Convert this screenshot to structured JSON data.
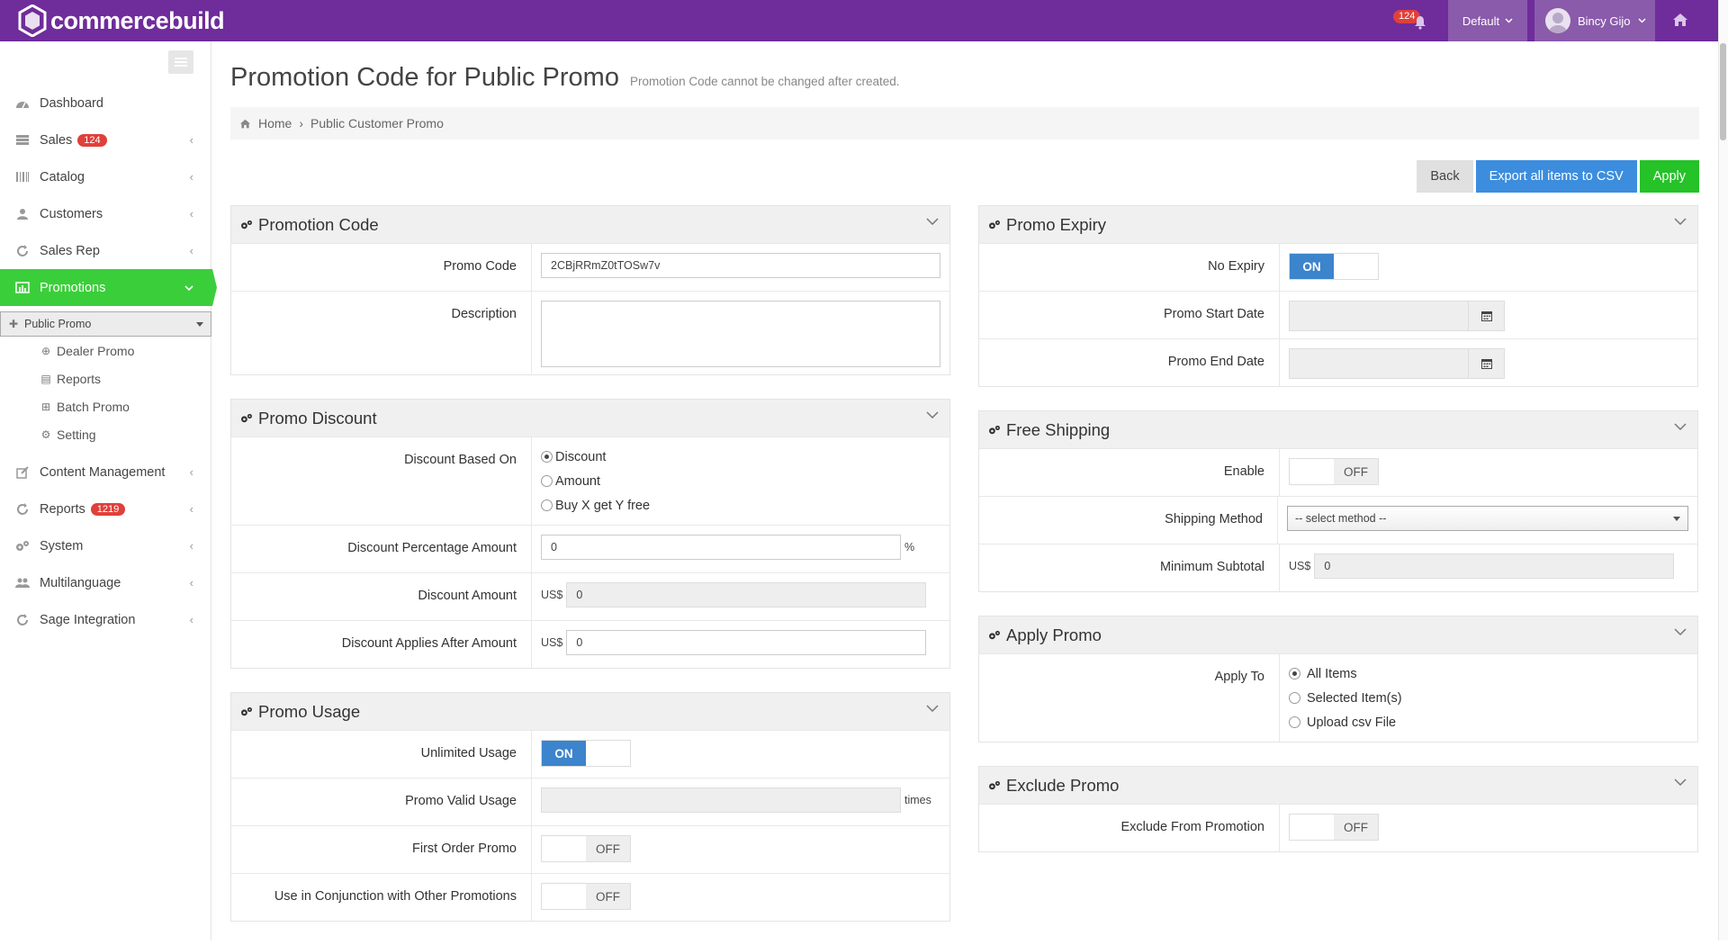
{
  "app": {
    "brand": "commercebuild",
    "notifications": "124",
    "store": "Default",
    "user": "Bincy Gijo"
  },
  "sidebar": {
    "items": [
      {
        "label": "Dashboard",
        "icon": "dashboard-icon"
      },
      {
        "label": "Sales",
        "icon": "sales-icon",
        "badge": "124"
      },
      {
        "label": "Catalog",
        "icon": "catalog-icon"
      },
      {
        "label": "Customers",
        "icon": "customers-icon"
      },
      {
        "label": "Sales Rep",
        "icon": "sales-rep-icon"
      },
      {
        "label": "Promotions",
        "icon": "promotions-icon"
      },
      {
        "label": "Content Management",
        "icon": "content-icon"
      },
      {
        "label": "Reports",
        "icon": "reports-icon",
        "badge": "1219"
      },
      {
        "label": "System",
        "icon": "system-icon"
      },
      {
        "label": "Multilanguage",
        "icon": "multilanguage-icon"
      },
      {
        "label": "Sage Integration",
        "icon": "sage-icon"
      }
    ],
    "promotions_sub": [
      {
        "label": "Public Promo",
        "icon": "plus-icon"
      },
      {
        "label": "Dealer Promo",
        "icon": "plus-circle-icon"
      },
      {
        "label": "Reports",
        "icon": "report-icon"
      },
      {
        "label": "Batch Promo",
        "icon": "plus-square-icon"
      },
      {
        "label": "Setting",
        "icon": "gear-icon"
      }
    ]
  },
  "page": {
    "title": "Promotion Code for Public Promo",
    "subtitle": "Promotion Code cannot be changed after created.",
    "breadcrumb": {
      "home": "Home",
      "current": "Public Customer Promo"
    }
  },
  "actions": {
    "back": "Back",
    "export": "Export all items to CSV",
    "apply": "Apply"
  },
  "promotion_code": {
    "title": "Promotion Code",
    "code_label": "Promo Code",
    "code_value": "2CBjRRmZ0tTOSw7v",
    "description_label": "Description",
    "description_value": ""
  },
  "promo_discount": {
    "title": "Promo Discount",
    "based_on_label": "Discount Based On",
    "options": [
      "Discount",
      "Amount",
      "Buy X get Y free"
    ],
    "selected": "Discount",
    "percentage_label": "Discount Percentage Amount",
    "percentage_value": "0",
    "percent_sign": "%",
    "amount_label": "Discount Amount",
    "amount_prefix": "US$",
    "amount_value": "0",
    "after_label": "Discount Applies After Amount",
    "after_prefix": "US$",
    "after_value": "0"
  },
  "promo_usage": {
    "title": "Promo Usage",
    "unlimited_label": "Unlimited Usage",
    "unlimited_state": "ON",
    "valid_label": "Promo Valid Usage",
    "valid_suffix": "times",
    "first_order_label": "First Order Promo",
    "first_order_state": "OFF",
    "conjunction_label": "Use in Conjunction with Other Promotions",
    "conjunction_state": "OFF"
  },
  "promo_expiry": {
    "title": "Promo Expiry",
    "no_expiry_label": "No Expiry",
    "no_expiry_state": "ON",
    "start_label": "Promo Start Date",
    "end_label": "Promo End Date"
  },
  "free_shipping": {
    "title": "Free Shipping",
    "enable_label": "Enable",
    "enable_state": "OFF",
    "method_label": "Shipping Method",
    "method_value": "-- select method --",
    "subtotal_label": "Minimum Subtotal",
    "subtotal_prefix": "US$",
    "subtotal_value": "0"
  },
  "apply_promo": {
    "title": "Apply Promo",
    "apply_to_label": "Apply To",
    "options": [
      "All Items",
      "Selected Item(s)",
      "Upload csv File"
    ],
    "selected": "All Items"
  },
  "exclude_promo": {
    "title": "Exclude Promo",
    "exclude_label": "Exclude From Promotion",
    "exclude_state": "OFF"
  },
  "colors": {
    "topbar": "#6f2c9b",
    "active_nav": "#3bce3b",
    "primary": "#3c8dde",
    "success": "#25c228",
    "badge": "#e0403a"
  }
}
